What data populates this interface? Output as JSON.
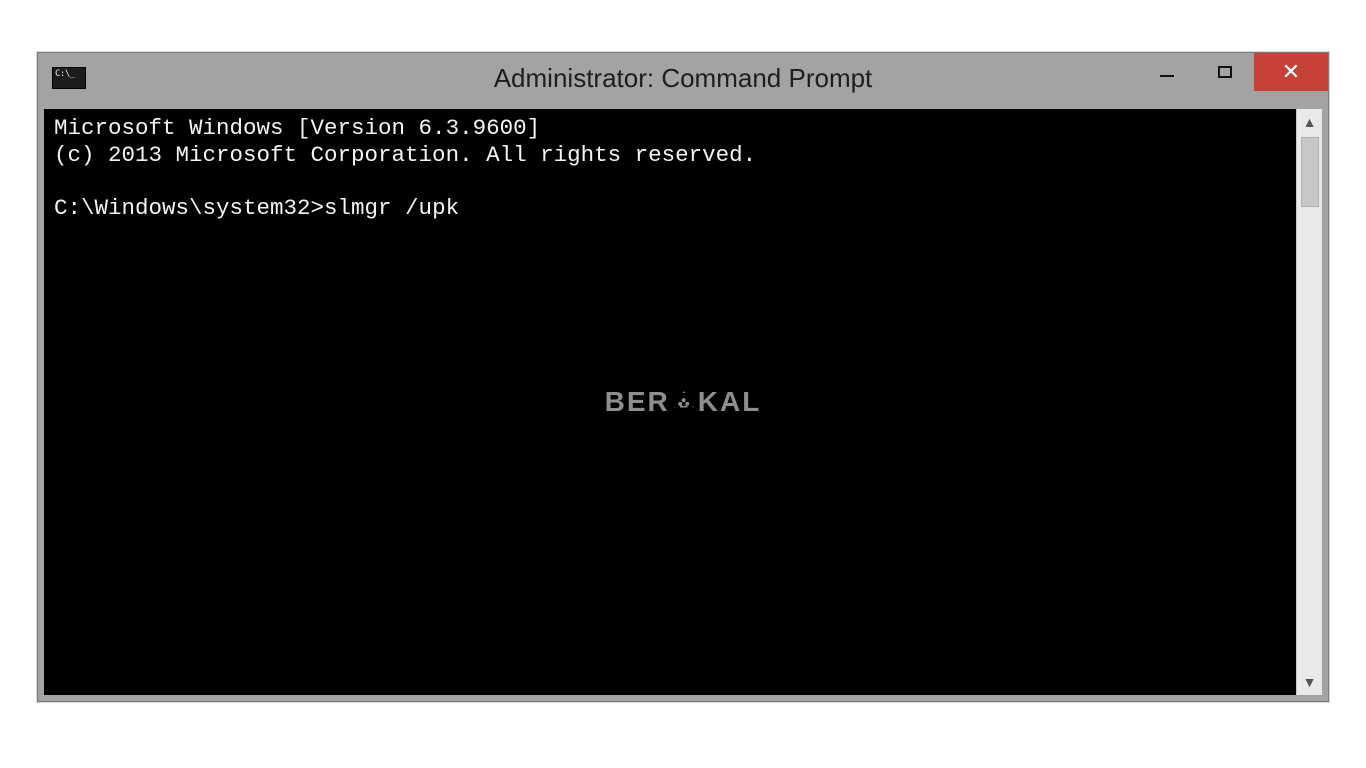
{
  "window": {
    "title": "Administrator: Command Prompt"
  },
  "console": {
    "line1": "Microsoft Windows [Version 6.3.9600]",
    "line2": "(c) 2013 Microsoft Corporation. All rights reserved.",
    "blank": "",
    "prompt": "C:\\Windows\\system32>",
    "command": "slmgr /upk"
  },
  "watermark": {
    "left": "BER",
    "right": "KAL"
  }
}
